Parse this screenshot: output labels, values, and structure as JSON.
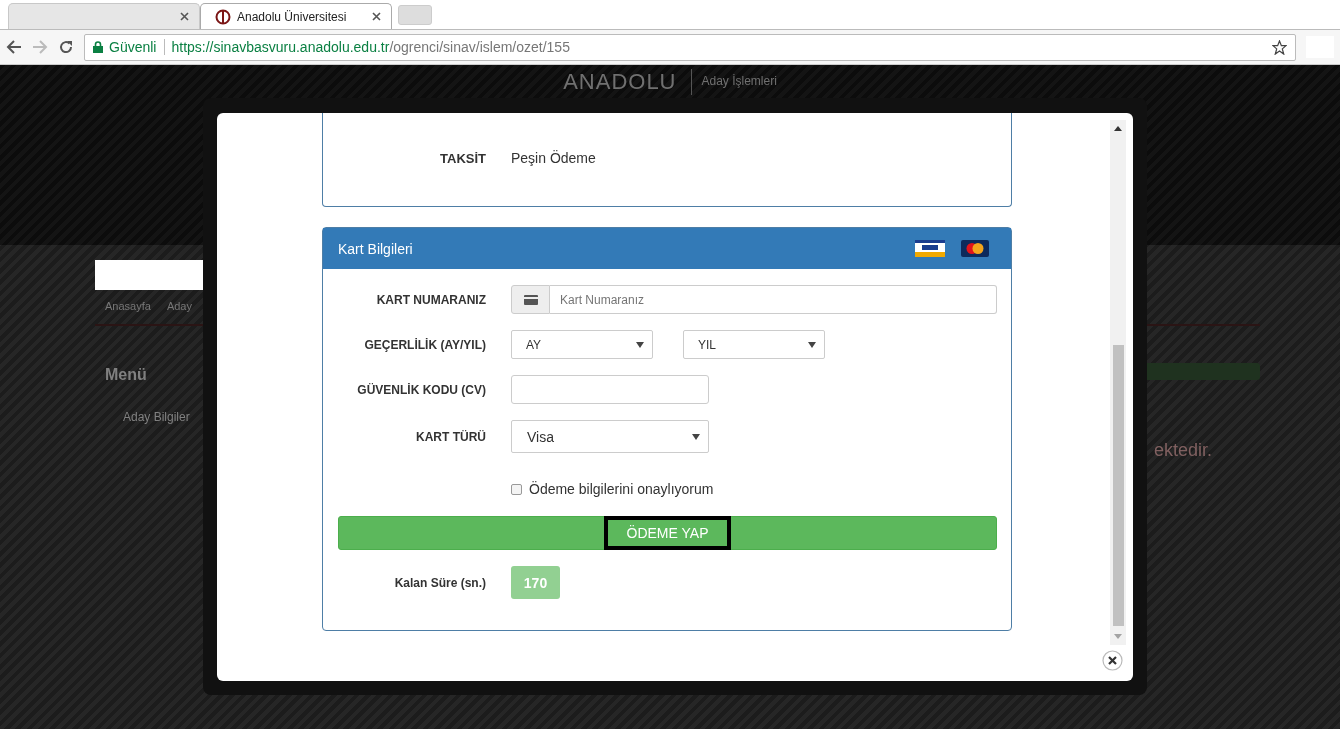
{
  "browser": {
    "tabs": [
      {
        "selected": false
      },
      {
        "title": "Anadolu Üniversitesi",
        "selected": true
      }
    ],
    "address_bar": {
      "security": "Güvenli",
      "url_host": "https://sinavbasvuru.anadolu.edu.tr",
      "url_path": "/ogrenci/sinav/islem/ozet/155"
    }
  },
  "page": {
    "logo": "ANADOLU",
    "logo_subtitle": "Aday İşlemleri",
    "breadcrumb": [
      "Anasayfa",
      "Aday"
    ],
    "menu_title": "Menü",
    "menu_items": [
      "Aday Bilgiler"
    ],
    "notice": "ektedir."
  },
  "modal": {
    "summary": {
      "label": "TAKSİT",
      "value": "Peşin Ödeme"
    },
    "card_panel": {
      "title": "Kart Bilgileri",
      "fields": [
        {
          "kind": "input-group",
          "label": "KART NUMARANIZ",
          "placeholder": "Kart Numaranız"
        },
        {
          "kind": "select-pair",
          "label": "GEÇERLİLİK (AY/YIL)",
          "values": [
            "AY",
            "YIL"
          ]
        },
        {
          "kind": "input",
          "label": "GÜVENLİK KODU (CV)"
        },
        {
          "kind": "select",
          "label": "KART TÜRÜ",
          "value": "Visa"
        }
      ],
      "confirm": {
        "label": "Ödeme bilgilerini onaylıyorum",
        "checked": false
      },
      "submit": {
        "label": "ÖDEME YAP",
        "focused": true
      },
      "timer": {
        "label": "Kalan Süre (sn.)",
        "value": "170"
      }
    }
  }
}
